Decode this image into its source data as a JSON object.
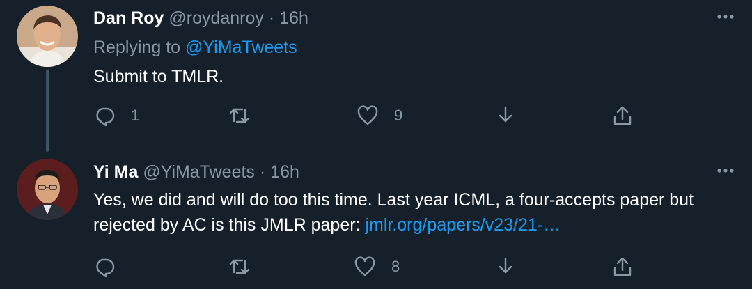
{
  "tweets": [
    {
      "display_name": "Dan Roy",
      "handle": "@roydanroy",
      "separator": "·",
      "time": "16h",
      "replying_prefix": "Replying to",
      "replying_to": "@YiMaTweets",
      "text": "Submit to TMLR.",
      "avatar_icon": "avatar-dan-roy",
      "actions": {
        "reply_count": "1",
        "retweet_count": "",
        "like_count": "9"
      }
    },
    {
      "display_name": "Yi Ma",
      "handle": "@YiMaTweets",
      "separator": "·",
      "time": "16h",
      "text_part1": "Yes, we did and will do too this time. Last year ICML, a four-accepts paper but rejected by AC is this JMLR paper: ",
      "link_text": "jmlr.org/papers/v23/21-…",
      "avatar_icon": "avatar-yi-ma",
      "actions": {
        "reply_count": "",
        "retweet_count": "",
        "like_count": "8"
      }
    }
  ],
  "icons": {
    "reply": "reply-icon",
    "retweet": "retweet-icon",
    "like": "like-icon",
    "bookmark": "bookmark-icon",
    "share": "share-icon",
    "more": "more-icon"
  },
  "colors": {
    "background": "#15202b",
    "secondary_text": "#8b98a5",
    "link": "#1d9bf0",
    "thread_line": "#3d5466"
  }
}
